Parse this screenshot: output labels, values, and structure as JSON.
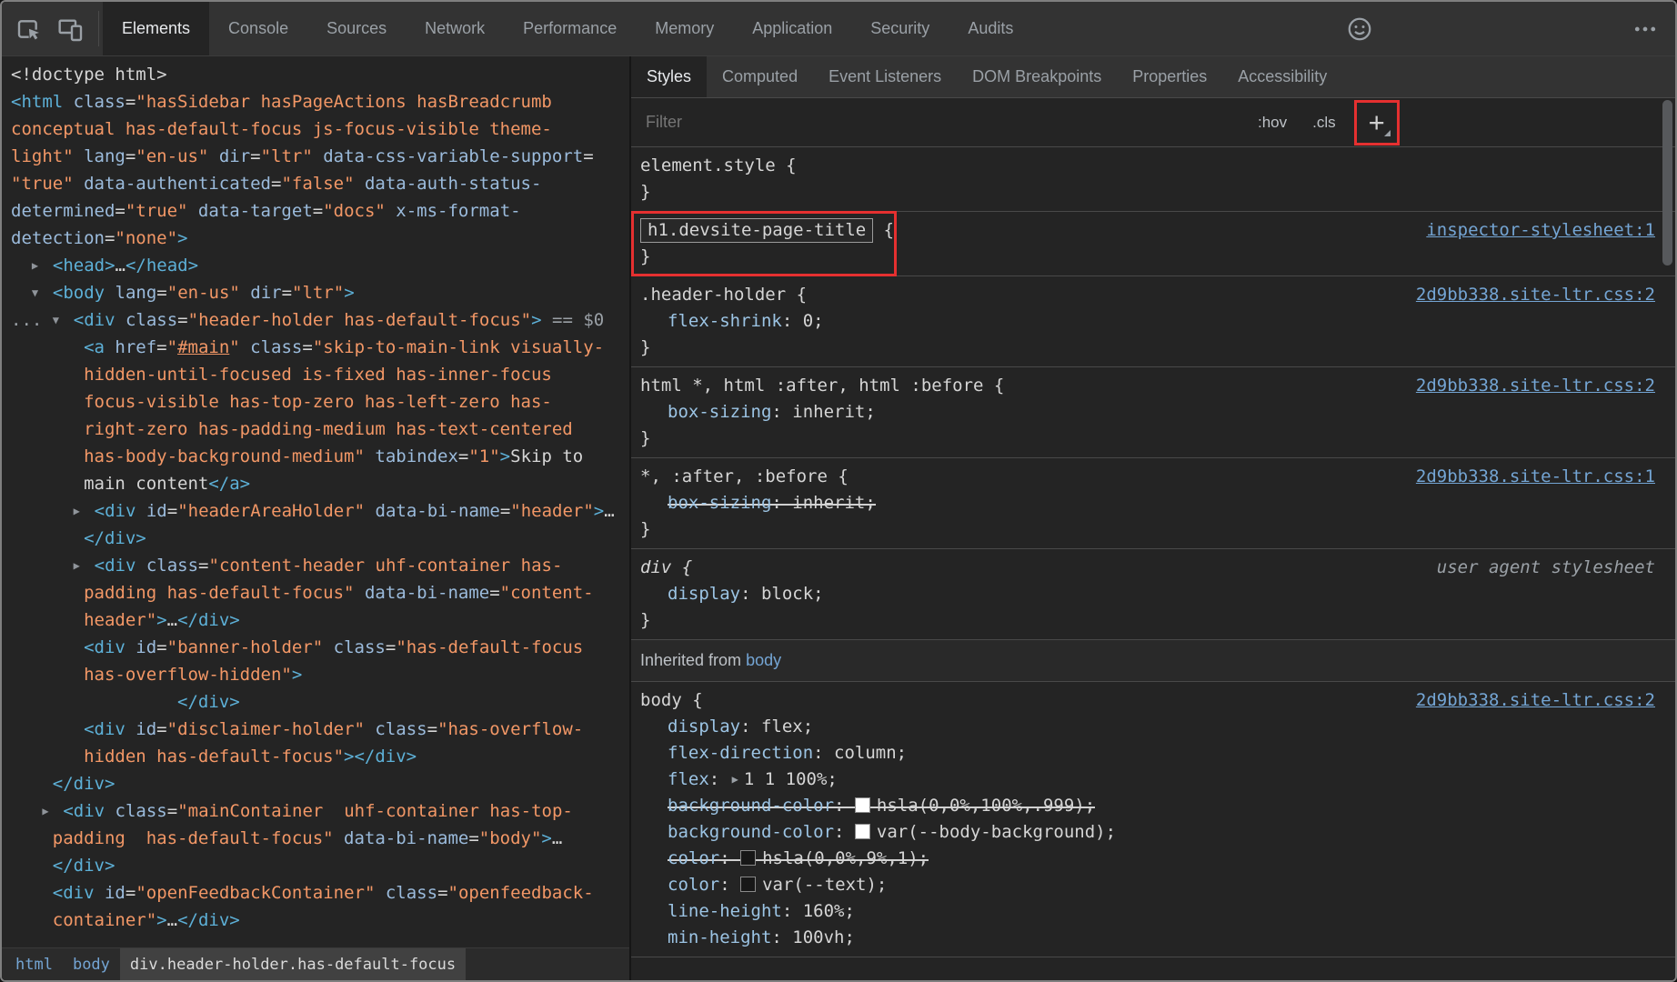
{
  "colors": {
    "annotation_red": "#e53030",
    "link_blue": "#74a5d4",
    "tag_blue": "#5db0d7",
    "attr_blue": "#9bbbdc",
    "value_orange": "#f29766",
    "property_blue": "#9cc4e4",
    "panel_bg": "#242424",
    "toolbar_bg": "#333333"
  },
  "toolbar": {
    "icons": [
      "inspect-element",
      "device-toolbar",
      "feedback-smiley",
      "more-options"
    ],
    "tabs": [
      {
        "label": "Elements",
        "active": true
      },
      {
        "label": "Console"
      },
      {
        "label": "Sources"
      },
      {
        "label": "Network"
      },
      {
        "label": "Performance"
      },
      {
        "label": "Memory"
      },
      {
        "label": "Application"
      },
      {
        "label": "Security"
      },
      {
        "label": "Audits"
      }
    ]
  },
  "dom_tree": {
    "lines": [
      [
        [
          "plain",
          "<!doctype html>"
        ]
      ],
      [
        [
          "tag",
          "<html"
        ],
        [
          "attr",
          " class"
        ],
        [
          "plain",
          "="
        ],
        [
          "val",
          "\"hasSidebar hasPageActions hasBreadcrumb"
        ]
      ],
      [
        [
          "val",
          "conceptual has-default-focus js-focus-visible theme-"
        ]
      ],
      [
        [
          "val",
          "light\""
        ],
        [
          "attr",
          " lang"
        ],
        [
          "plain",
          "="
        ],
        [
          "val",
          "\"en-us\""
        ],
        [
          "attr",
          " dir"
        ],
        [
          "plain",
          "="
        ],
        [
          "val",
          "\"ltr\""
        ],
        [
          "attr",
          " data-css-variable-support"
        ],
        [
          "plain",
          "="
        ]
      ],
      [
        [
          "val",
          "\"true\""
        ],
        [
          "attr",
          " data-authenticated"
        ],
        [
          "plain",
          "="
        ],
        [
          "val",
          "\"false\""
        ],
        [
          "attr",
          " data-auth-status-"
        ]
      ],
      [
        [
          "attr",
          "determined"
        ],
        [
          "plain",
          "="
        ],
        [
          "val",
          "\"true\""
        ],
        [
          "attr",
          " data-target"
        ],
        [
          "plain",
          "="
        ],
        [
          "val",
          "\"docs\""
        ],
        [
          "attr",
          " x-ms-format-"
        ]
      ],
      [
        [
          "attr",
          "detection"
        ],
        [
          "plain",
          "="
        ],
        [
          "val",
          "\"none\""
        ],
        [
          "tag",
          ">"
        ]
      ],
      [
        [
          "plain",
          "  "
        ],
        [
          "arrow",
          "▶"
        ],
        [
          "tag",
          "<head>"
        ],
        [
          "plain",
          "…"
        ],
        [
          "tag",
          "</head>"
        ]
      ],
      [
        [
          "plain",
          "  "
        ],
        [
          "arrow",
          "▼"
        ],
        [
          "tag",
          "<body"
        ],
        [
          "attr",
          " lang"
        ],
        [
          "plain",
          "="
        ],
        [
          "val",
          "\"en-us\""
        ],
        [
          "attr",
          " dir"
        ],
        [
          "plain",
          "="
        ],
        [
          "val",
          "\"ltr\""
        ],
        [
          "tag",
          ">"
        ]
      ],
      [
        [
          "grey",
          "... "
        ],
        [
          "arrow",
          "▼"
        ],
        [
          "tag",
          "<div"
        ],
        [
          "attr",
          " class"
        ],
        [
          "plain",
          "="
        ],
        [
          "val",
          "\"header-holder has-default-focus\""
        ],
        [
          "tag",
          ">"
        ],
        [
          "grey",
          " == $0"
        ]
      ],
      [
        [
          "plain",
          "       "
        ],
        [
          "tag",
          "<a"
        ],
        [
          "attr",
          " href"
        ],
        [
          "plain",
          "="
        ],
        [
          "val",
          "\""
        ],
        [
          "vallink",
          "#main"
        ],
        [
          "val",
          "\""
        ],
        [
          "attr",
          " class"
        ],
        [
          "plain",
          "="
        ],
        [
          "val",
          "\"skip-to-main-link visually-"
        ]
      ],
      [
        [
          "val",
          "       hidden-until-focused is-fixed has-inner-focus"
        ]
      ],
      [
        [
          "val",
          "       focus-visible has-top-zero has-left-zero has-"
        ]
      ],
      [
        [
          "val",
          "       right-zero has-padding-medium has-text-centered"
        ]
      ],
      [
        [
          "val",
          "       has-body-background-medium\""
        ],
        [
          "attr",
          " tabindex"
        ],
        [
          "plain",
          "="
        ],
        [
          "val",
          "\"1\""
        ],
        [
          "tag",
          ">"
        ],
        [
          "plain",
          "Skip to"
        ]
      ],
      [
        [
          "plain",
          "       main content"
        ],
        [
          "tag",
          "</a>"
        ]
      ],
      [
        [
          "plain",
          "      "
        ],
        [
          "arrow",
          "▶"
        ],
        [
          "tag",
          "<div"
        ],
        [
          "attr",
          " id"
        ],
        [
          "plain",
          "="
        ],
        [
          "val",
          "\"headerAreaHolder\""
        ],
        [
          "attr",
          " data-bi-name"
        ],
        [
          "plain",
          "="
        ],
        [
          "val",
          "\"header\""
        ],
        [
          "tag",
          ">"
        ],
        [
          "plain",
          "…"
        ]
      ],
      [
        [
          "plain",
          "       "
        ],
        [
          "tag",
          "</div>"
        ]
      ],
      [
        [
          "plain",
          "      "
        ],
        [
          "arrow",
          "▶"
        ],
        [
          "tag",
          "<div"
        ],
        [
          "attr",
          " class"
        ],
        [
          "plain",
          "="
        ],
        [
          "val",
          "\"content-header uhf-container has-"
        ]
      ],
      [
        [
          "val",
          "       padding has-default-focus\""
        ],
        [
          "attr",
          " data-bi-name"
        ],
        [
          "plain",
          "="
        ],
        [
          "val",
          "\"content-"
        ]
      ],
      [
        [
          "val",
          "       header\""
        ],
        [
          "tag",
          ">"
        ],
        [
          "plain",
          "…"
        ],
        [
          "tag",
          "</div>"
        ]
      ],
      [
        [
          "plain",
          "       "
        ],
        [
          "tag",
          "<div"
        ],
        [
          "attr",
          " id"
        ],
        [
          "plain",
          "="
        ],
        [
          "val",
          "\"banner-holder\""
        ],
        [
          "attr",
          " class"
        ],
        [
          "plain",
          "="
        ],
        [
          "val",
          "\"has-default-focus"
        ]
      ],
      [
        [
          "val",
          "       has-overflow-hidden\""
        ],
        [
          "tag",
          ">"
        ]
      ],
      [
        [
          "plain",
          "                "
        ],
        [
          "tag",
          "</div>"
        ]
      ],
      [
        [
          "plain",
          "       "
        ],
        [
          "tag",
          "<div"
        ],
        [
          "attr",
          " id"
        ],
        [
          "plain",
          "="
        ],
        [
          "val",
          "\"disclaimer-holder\""
        ],
        [
          "attr",
          " class"
        ],
        [
          "plain",
          "="
        ],
        [
          "val",
          "\"has-overflow-"
        ]
      ],
      [
        [
          "val",
          "       hidden has-default-focus\""
        ],
        [
          "tag",
          "></div>"
        ]
      ],
      [
        [
          "plain",
          "    "
        ],
        [
          "tag",
          "</div>"
        ]
      ],
      [
        [
          "plain",
          "   "
        ],
        [
          "arrow",
          "▶"
        ],
        [
          "tag",
          "<div"
        ],
        [
          "attr",
          " class"
        ],
        [
          "plain",
          "="
        ],
        [
          "val",
          "\"mainContainer  uhf-container has-top-"
        ]
      ],
      [
        [
          "val",
          "    padding  has-default-focus\""
        ],
        [
          "attr",
          " data-bi-name"
        ],
        [
          "plain",
          "="
        ],
        [
          "val",
          "\"body\""
        ],
        [
          "tag",
          ">"
        ],
        [
          "plain",
          "…"
        ]
      ],
      [
        [
          "plain",
          "    "
        ],
        [
          "tag",
          "</div>"
        ]
      ],
      [
        [
          "plain",
          "    "
        ],
        [
          "tag",
          "<div"
        ],
        [
          "attr",
          " id"
        ],
        [
          "plain",
          "="
        ],
        [
          "val",
          "\"openFeedbackContainer\""
        ],
        [
          "attr",
          " class"
        ],
        [
          "plain",
          "="
        ],
        [
          "val",
          "\"openfeedback-"
        ]
      ],
      [
        [
          "val",
          "    container\""
        ],
        [
          "tag",
          ">"
        ],
        [
          "plain",
          "…"
        ],
        [
          "tag",
          "</div>"
        ]
      ]
    ]
  },
  "breadcrumbs": [
    {
      "label": "html"
    },
    {
      "label": "body"
    },
    {
      "label": "div.header-holder.has-default-focus",
      "selected": true
    }
  ],
  "styles_panel": {
    "tabs": [
      {
        "label": "Styles",
        "active": true
      },
      {
        "label": "Computed"
      },
      {
        "label": "Event Listeners"
      },
      {
        "label": "DOM Breakpoints"
      },
      {
        "label": "Properties"
      },
      {
        "label": "Accessibility"
      }
    ],
    "filter_placeholder": "Filter",
    "toggles": [
      ":hov",
      ".cls"
    ],
    "add_rule_label": "+",
    "rules": [
      {
        "selector": "element.style",
        "decls": []
      },
      {
        "selector": "h1.devsite-page-title",
        "selector_boxed": true,
        "annotated": true,
        "decls": [],
        "link": "inspector-stylesheet:1"
      },
      {
        "selector": ".header-holder",
        "decls": [
          {
            "name": "flex-shrink",
            "value": "0"
          }
        ],
        "link": "2d9bb338.site-ltr.css:2"
      },
      {
        "selector": "html *, html :after, html :before",
        "decls": [
          {
            "name": "box-sizing",
            "value": "inherit"
          }
        ],
        "link": "2d9bb338.site-ltr.css:2"
      },
      {
        "selector": "*, :after, :before",
        "decls": [
          {
            "name": "box-sizing",
            "value": "inherit",
            "struck": true
          }
        ],
        "link": "2d9bb338.site-ltr.css:1"
      },
      {
        "selector": "div",
        "italic": true,
        "origin": "user agent stylesheet",
        "decls": [
          {
            "name": "display",
            "value": "block"
          }
        ]
      },
      {
        "type": "section",
        "text": "Inherited from",
        "link": "body"
      },
      {
        "selector": "body",
        "close": false,
        "link": "2d9bb338.site-ltr.css:2",
        "decls": [
          {
            "name": "display",
            "value": "flex"
          },
          {
            "name": "flex-direction",
            "value": "column"
          },
          {
            "name": "flex",
            "value": "1 1 100%",
            "expand": true
          },
          {
            "name": "background-color",
            "value": "hsla(0,0%,100%,.999)",
            "struck": true,
            "swatch": "#ffffff"
          },
          {
            "name": "background-color",
            "value": "var(--body-background)",
            "swatch": "#ffffff"
          },
          {
            "name": "color",
            "value": "hsla(0,0%,9%,1)",
            "struck": true,
            "swatch": "#171717"
          },
          {
            "name": "color",
            "value": "var(--text)",
            "swatch": "#171717"
          },
          {
            "name": "line-height",
            "value": "160%"
          },
          {
            "name": "min-height",
            "value": "100vh"
          }
        ]
      }
    ]
  }
}
